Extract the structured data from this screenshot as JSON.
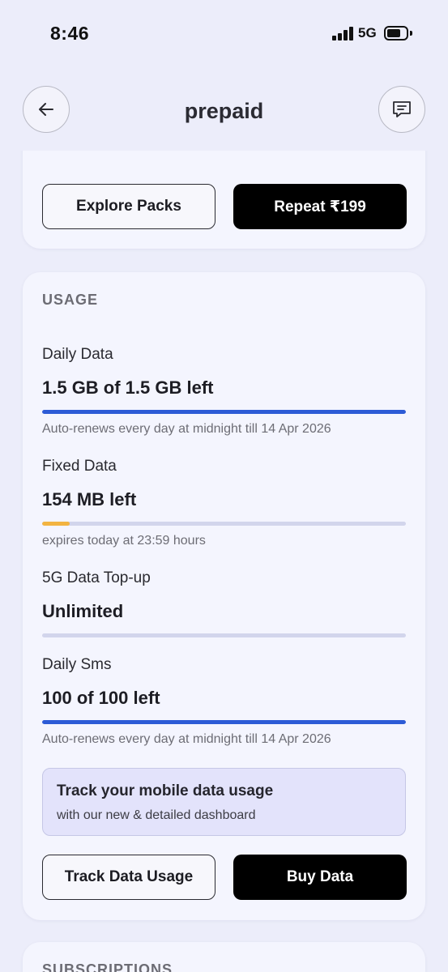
{
  "status": {
    "time": "8:46",
    "network": "5G",
    "battery_level": 0.72
  },
  "header": {
    "title": "prepaid",
    "back_icon": "arrow-left-icon",
    "chat_icon": "chat-bubble-icon"
  },
  "plan_actions": {
    "explore_label": "Explore Packs",
    "repeat_label": "Repeat ₹199"
  },
  "usage": {
    "section_title": "USAGE",
    "items": [
      {
        "label": "Daily Data",
        "value": "1.5 GB of 1.5 GB left",
        "progress": 1.0,
        "bar_color": "#2c5bd6",
        "note": "Auto-renews every day at midnight till 14 Apr 2026"
      },
      {
        "label": "Fixed Data",
        "value": "154 MB left",
        "progress": 0.075,
        "bar_color": "#f2b441",
        "note": "expires today at 23:59 hours"
      },
      {
        "label": "5G Data Top-up",
        "value": "Unlimited",
        "progress": 0,
        "bar_color": "#2c5bd6",
        "note": ""
      },
      {
        "label": "Daily Sms",
        "value": "100 of 100 left",
        "progress": 1.0,
        "bar_color": "#2c5bd6",
        "note": "Auto-renews every day at midnight till 14 Apr 2026"
      }
    ],
    "promo": {
      "title": "Track your mobile data usage",
      "subtitle": "with our new & detailed dashboard"
    },
    "track_label": "Track Data Usage",
    "buy_label": "Buy Data"
  },
  "subscriptions": {
    "section_title": "SUBSCRIPTIONS"
  }
}
